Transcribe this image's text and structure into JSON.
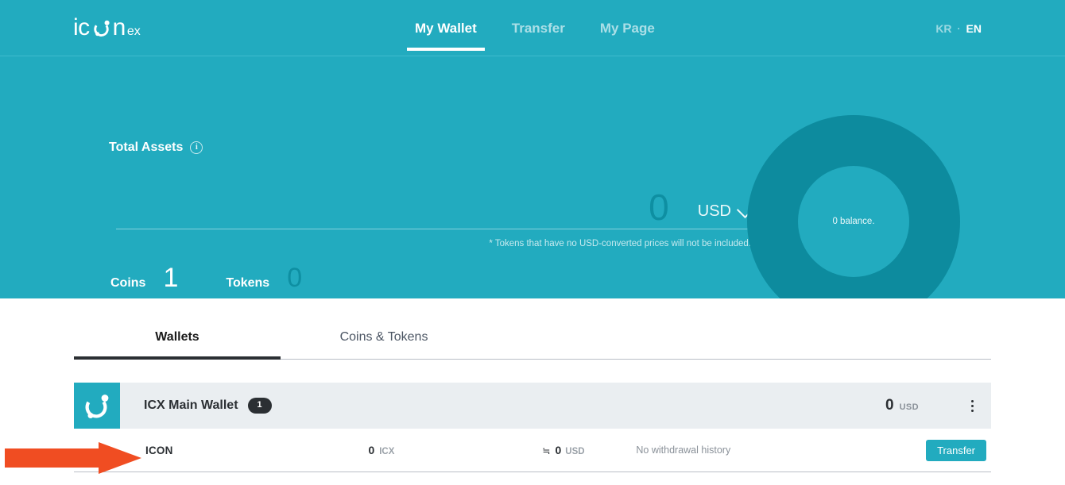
{
  "header": {
    "logo_main": "icon",
    "logo_suffix": "ex",
    "nav": [
      {
        "label": "My Wallet",
        "active": true
      },
      {
        "label": "Transfer",
        "active": false
      },
      {
        "label": "My Page",
        "active": false
      }
    ],
    "lang": {
      "kr": "KR",
      "separator": "·",
      "en": "EN",
      "active": "EN"
    }
  },
  "hero": {
    "total_assets_label": "Total Assets",
    "info_icon": "info-icon",
    "amount": "0",
    "currency": "USD",
    "note": "* Tokens that have no USD-converted prices will not be included.",
    "coins_label": "Coins",
    "coins_count": "1",
    "tokens_label": "Tokens",
    "tokens_count": "0",
    "donut_text": "0 balance.",
    "colors": {
      "background": "#22abbf",
      "donut_ring": "#0d8b9e",
      "dim_number": "#0e8fa2"
    }
  },
  "tabs": [
    {
      "label": "Wallets",
      "active": true
    },
    {
      "label": "Coins & Tokens",
      "active": false
    }
  ],
  "wallets": [
    {
      "name": "ICX Main Wallet",
      "badge": "1",
      "total_value": "0",
      "total_currency": "USD",
      "menu_icon": "kebab-menu-icon",
      "coins": [
        {
          "name": "ICON",
          "amount": "0",
          "symbol": "ICX",
          "approx_symbol": "≒",
          "usd_value": "0",
          "usd_currency": "USD",
          "history": "No withdrawal history",
          "action_label": "Transfer"
        }
      ]
    }
  ],
  "annotation": {
    "arrow": "red-arrow-pointing-right",
    "color": "#f04d22"
  }
}
